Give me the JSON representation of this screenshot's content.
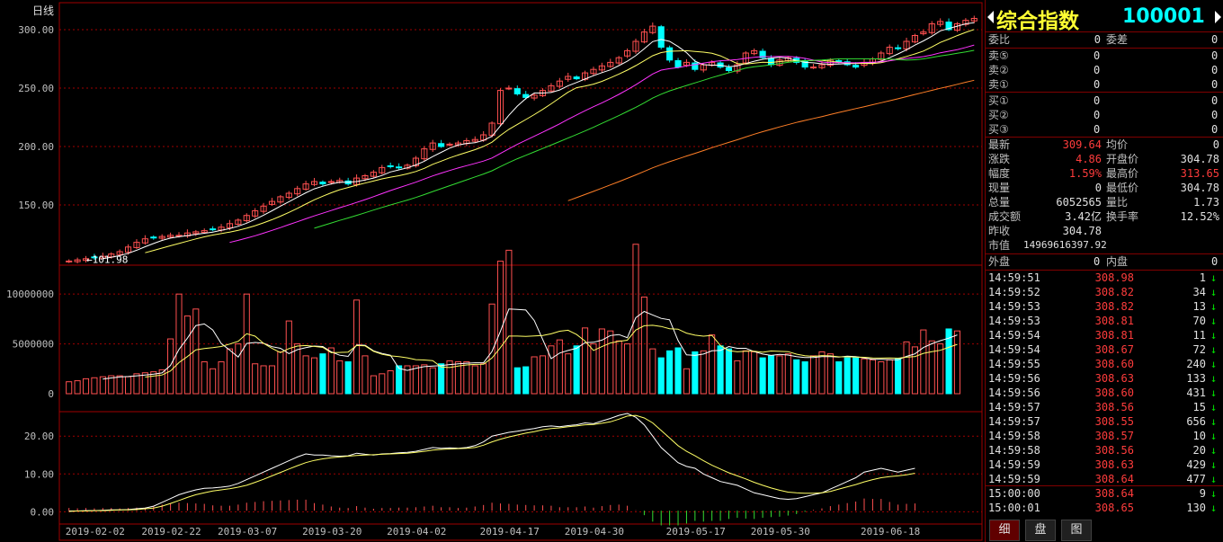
{
  "chart": {
    "period_label": "日线",
    "first_price_label": "101.98"
  },
  "chart_data": [
    {
      "type": "candlestick",
      "title": "",
      "ylim": [
        100,
        310
      ],
      "yticks": [
        "300.00",
        "250.00",
        "200.00",
        "150.00"
      ],
      "yticks_values": [
        300,
        250,
        200,
        150
      ],
      "xticks": [
        "2019-02-02",
        "2019-02-22",
        "2019-03-07",
        "2019-03-20",
        "2019-04-02",
        "2019-04-17",
        "2019-04-30",
        "2019-05-17",
        "2019-05-30",
        "2019-06-18"
      ],
      "close": [
        101.98,
        103,
        104,
        105,
        106,
        108,
        110,
        114,
        118,
        121,
        122,
        123,
        124,
        124,
        126,
        127,
        128,
        129,
        131,
        134,
        137,
        141,
        145,
        149,
        153,
        157,
        160,
        164,
        168,
        170,
        168,
        170,
        171,
        168,
        173,
        175,
        178,
        182,
        183,
        182,
        184,
        190,
        198,
        203,
        200,
        202,
        203,
        205,
        206,
        210,
        220,
        248,
        250,
        245,
        242,
        244,
        248,
        252,
        256,
        260,
        258,
        263,
        266,
        269,
        272,
        276,
        282,
        290,
        298,
        303,
        285,
        274,
        268,
        272,
        266,
        270,
        272,
        268,
        265,
        270,
        280,
        282,
        276,
        270,
        274,
        276,
        272,
        268,
        268,
        270,
        274,
        273,
        270,
        268,
        272,
        275,
        280,
        285,
        284,
        290,
        295,
        298,
        305,
        307,
        300,
        305,
        308,
        309.64
      ],
      "ma_labels": [
        "MA5",
        "MA10",
        "MA20",
        "MA60"
      ],
      "ma_colors": [
        "#ffffff",
        "#ffff66",
        "#ff33ff",
        "#33dd33"
      ],
      "ma_long_color": "#ff7f27"
    },
    {
      "type": "bar",
      "title": "",
      "ylim": [
        0,
        12000000
      ],
      "yticks": [
        "10000000",
        "5000000",
        "0"
      ],
      "yticks_values": [
        10000000,
        5000000,
        0
      ],
      "volume": [
        1.2,
        1.3,
        1.5,
        1.6,
        1.7,
        1.8,
        1.8,
        1.7,
        2.0,
        2.1,
        2.2,
        2.4,
        5.5,
        10.0,
        7.8,
        8.5,
        3.2,
        2.5,
        3.2,
        4.5,
        5.0,
        10.0,
        3.0,
        2.8,
        2.8,
        4.2,
        7.3,
        5.0,
        3.8,
        3.6,
        4.0,
        4.6,
        3.3,
        3.2,
        9.4,
        3.8,
        1.8,
        2.0,
        2.3,
        2.8,
        2.8,
        2.8,
        2.9,
        2.6,
        3.0,
        3.3,
        3.2,
        3.2,
        2.8,
        3.0,
        9.0,
        13.3,
        14.4,
        2.6,
        2.7,
        3.7,
        3.8,
        4.8,
        5.4,
        4.0,
        4.8,
        6.6,
        5.0,
        6.5,
        6.3,
        5.3,
        5.0,
        15.0,
        9.7,
        4.5,
        3.6,
        4.3,
        4.6,
        2.5,
        4.2,
        4.3,
        5.9,
        4.8,
        4.5,
        3.3,
        4.3,
        4.2,
        3.6,
        3.8,
        3.8,
        4.0,
        3.4,
        3.2,
        3.8,
        4.2,
        4.0,
        3.2,
        3.6,
        3.6,
        3.5,
        3.4,
        3.2,
        3.4,
        3.5,
        5.2,
        4.7,
        6.4,
        5.3,
        5.0,
        6.5,
        6.3
      ],
      "volume_unit": 1000000
    },
    {
      "type": "line",
      "title": "",
      "ylim": [
        -3,
        26
      ],
      "yticks": [
        "20.00",
        "10.00",
        "0.00"
      ],
      "yticks_values": [
        20,
        10,
        0
      ],
      "series": [
        {
          "values": [
            0.2,
            0.2,
            0.3,
            0.3,
            0.4,
            0.5,
            0.5,
            0.6,
            0.8,
            1.0,
            1.5,
            2.5,
            3.5,
            4.5,
            5.2,
            5.8,
            6.2,
            6.3,
            6.5,
            6.8,
            7.5,
            8.5,
            9.5,
            10.5,
            11.5,
            12.5,
            13.5,
            14.5,
            15.3,
            15.0,
            15.0,
            14.8,
            14.7,
            14.8,
            15.5,
            15.2,
            15.0,
            15.3,
            15.4,
            15.6,
            15.7,
            16.0,
            16.5,
            17.0,
            16.8,
            16.9,
            16.8,
            17.0,
            17.5,
            18.5,
            20.0,
            20.5,
            21.0,
            21.3,
            21.7,
            22.0,
            22.5,
            22.7,
            22.5,
            22.8,
            23.0,
            23.5,
            23.3,
            24.0,
            24.7,
            25.5,
            26.0,
            25.0,
            23.0,
            20.0,
            17.0,
            15.0,
            13.0,
            12.0,
            11.5,
            10.0,
            9.0,
            8.0,
            7.5,
            7.0,
            6.0,
            5.0,
            4.5,
            4.0,
            3.5,
            3.3,
            3.5,
            4.0,
            4.5,
            5.0,
            6.0,
            7.0,
            8.0,
            9.0,
            10.5,
            11.0,
            11.5,
            11.0,
            10.5,
            11.0,
            11.5
          ]
        },
        {
          "values": [
            0.1,
            0.2,
            0.2,
            0.3,
            0.3,
            0.4,
            0.5,
            0.5,
            0.6,
            0.8,
            1.0,
            1.5,
            2.2,
            3.0,
            3.8,
            4.5,
            5.0,
            5.5,
            5.8,
            6.1,
            6.5,
            7.0,
            7.8,
            8.6,
            9.5,
            10.4,
            11.3,
            12.2,
            13.0,
            13.6,
            14.0,
            14.3,
            14.5,
            14.7,
            14.9,
            15.0,
            15.1,
            15.2,
            15.3,
            15.4,
            15.5,
            15.7,
            16.0,
            16.3,
            16.5,
            16.6,
            16.7,
            16.8,
            17.0,
            17.6,
            18.5,
            19.2,
            19.8,
            20.3,
            20.8,
            21.2,
            21.7,
            22.0,
            22.2,
            22.5,
            22.7,
            23.0,
            23.1,
            23.4,
            23.8,
            24.5,
            25.3,
            25.5,
            24.8,
            23.5,
            21.5,
            19.5,
            17.5,
            16.0,
            14.8,
            13.5,
            12.3,
            11.3,
            10.3,
            9.5,
            8.7,
            7.8,
            7.0,
            6.3,
            5.7,
            5.2,
            5.0,
            4.9,
            4.9,
            5.0,
            5.4,
            6.0,
            6.6,
            7.2,
            7.9,
            8.5,
            9.0,
            9.3,
            9.5,
            9.8,
            10.2
          ]
        }
      ],
      "macd_scale": 1
    }
  ],
  "panel": {
    "name": "综合指数",
    "code": "100001",
    "weibi_label": "委比",
    "weibi_val": "0",
    "weicha_label": "委差",
    "weicha_val": "0",
    "sell": [
      {
        "label": "卖⑤",
        "price": "0",
        "vol": "0"
      },
      {
        "label": "卖②",
        "price": "0",
        "vol": "0"
      },
      {
        "label": "卖①",
        "price": "0",
        "vol": "0"
      }
    ],
    "buy": [
      {
        "label": "买①",
        "price": "0",
        "vol": "0"
      },
      {
        "label": "买②",
        "price": "0",
        "vol": "0"
      },
      {
        "label": "买③",
        "price": "0",
        "vol": "0"
      }
    ],
    "stats": [
      {
        "l1": "最新",
        "v1": "309.64",
        "c1": "red",
        "l2": "均价",
        "v2": "0",
        "c2": "white"
      },
      {
        "l1": "涨跌",
        "v1": "4.86",
        "c1": "red",
        "l2": "开盘价",
        "v2": "304.78",
        "c2": "white"
      },
      {
        "l1": "幅度",
        "v1": "1.59%",
        "c1": "red",
        "l2": "最高价",
        "v2": "313.65",
        "c2": "red"
      },
      {
        "l1": "现量",
        "v1": "0",
        "c1": "white",
        "l2": "最低价",
        "v2": "304.78",
        "c2": "white"
      },
      {
        "l1": "总量",
        "v1": "6052565",
        "c1": "white",
        "l2": "量比",
        "v2": "1.73",
        "c2": "white"
      },
      {
        "l1": "成交额",
        "v1": "3.42亿",
        "c1": "white",
        "l2": "换手率",
        "v2": "12.52%",
        "c2": "white"
      },
      {
        "l1": "昨收",
        "v1": "304.78",
        "c1": "white",
        "l2": "",
        "v2": "",
        "c2": "white"
      },
      {
        "l1": "市值",
        "v1": "14969616397.92",
        "c1": "white",
        "l2": "",
        "v2": "",
        "c2": "white"
      }
    ],
    "outer_label": "外盘",
    "outer_val": "0",
    "inner_label": "内盘",
    "inner_val": "0",
    "ticks": [
      {
        "t": "14:59:51",
        "p": "308.98",
        "v": "1",
        "c": "red"
      },
      {
        "t": "14:59:52",
        "p": "308.82",
        "v": "34",
        "c": "red"
      },
      {
        "t": "14:59:53",
        "p": "308.82",
        "v": "13",
        "c": "red"
      },
      {
        "t": "14:59:53",
        "p": "308.81",
        "v": "70",
        "c": "red"
      },
      {
        "t": "14:59:54",
        "p": "308.81",
        "v": "11",
        "c": "red"
      },
      {
        "t": "14:59:54",
        "p": "308.67",
        "v": "72",
        "c": "red"
      },
      {
        "t": "14:59:55",
        "p": "308.60",
        "v": "240",
        "c": "red"
      },
      {
        "t": "14:59:56",
        "p": "308.63",
        "v": "133",
        "c": "red"
      },
      {
        "t": "14:59:56",
        "p": "308.60",
        "v": "431",
        "c": "red"
      },
      {
        "t": "14:59:57",
        "p": "308.56",
        "v": "15",
        "c": "red"
      },
      {
        "t": "14:59:57",
        "p": "308.55",
        "v": "656",
        "c": "red"
      },
      {
        "t": "14:59:58",
        "p": "308.57",
        "v": "10",
        "c": "red"
      },
      {
        "t": "14:59:58",
        "p": "308.56",
        "v": "20",
        "c": "red"
      },
      {
        "t": "14:59:59",
        "p": "308.63",
        "v": "429",
        "c": "red"
      },
      {
        "t": "14:59:59",
        "p": "308.64",
        "v": "477",
        "c": "red"
      },
      {
        "t": "15:00:00",
        "p": "308.64",
        "v": "9",
        "c": "red"
      },
      {
        "t": "15:00:01",
        "p": "308.65",
        "v": "130",
        "c": "red"
      }
    ],
    "tabs": [
      "细",
      "盘",
      "图"
    ]
  }
}
